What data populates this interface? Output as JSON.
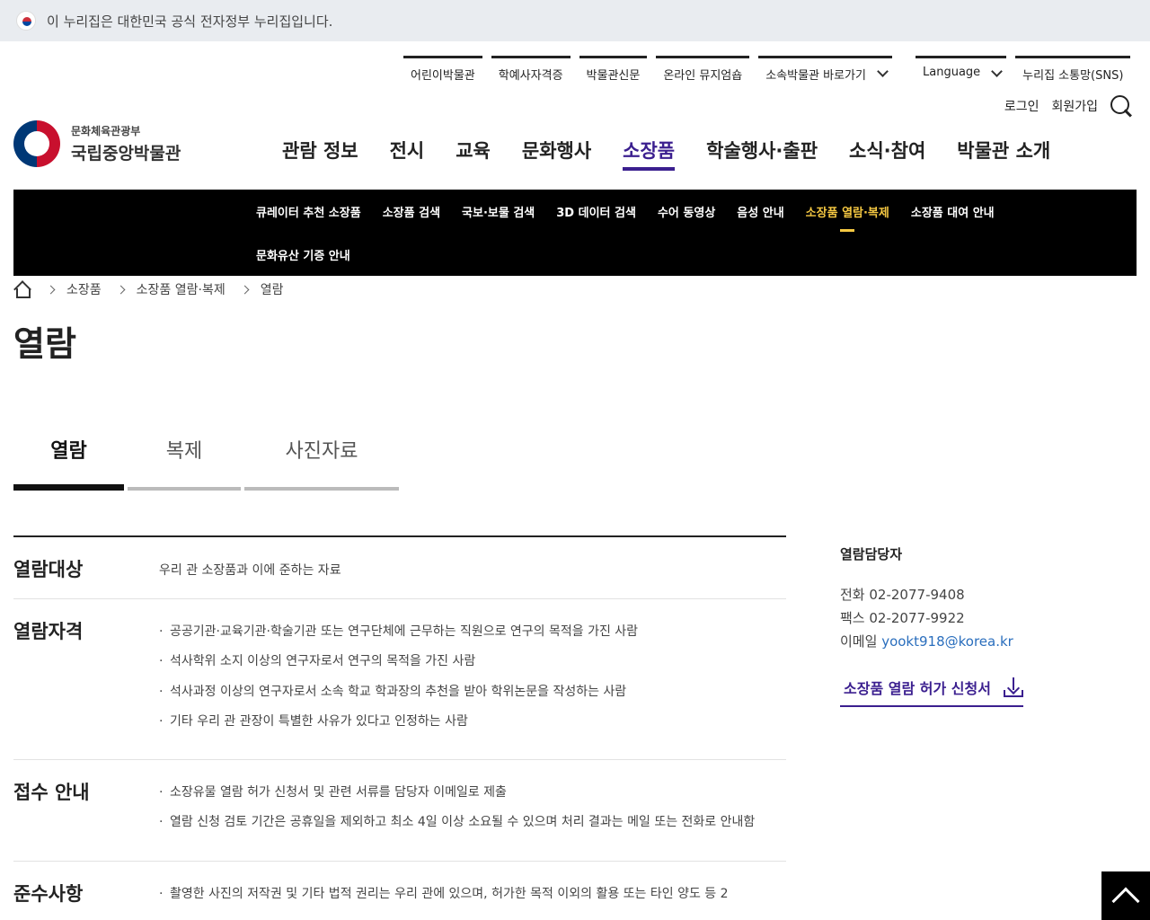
{
  "gov_banner": {
    "text": "이 누리집은 대한민국 공식 전자정부 누리집입니다."
  },
  "util_nav": {
    "items": [
      "어린이박물관",
      "학예사자격증",
      "박물관신문",
      "온라인 뮤지엄숍",
      "소속박물관 바로가기"
    ],
    "language": "Language",
    "sns": "누리집 소통망(SNS)"
  },
  "auth": {
    "login": "로그인",
    "signup": "회원가입"
  },
  "logo": {
    "sub": "문화체육관광부",
    "main": "국립중앙박물관"
  },
  "gnb": {
    "items": [
      "관람 정보",
      "전시",
      "교육",
      "문화행사",
      "소장품",
      "학술행사·출판",
      "소식·참여",
      "박물관 소개"
    ],
    "active_index": 4
  },
  "subnav": {
    "items": [
      "큐레이터 추천 소장품",
      "소장품 검색",
      "국보·보물 검색",
      "3D 데이터 검색",
      "수어 동영상",
      "음성 안내",
      "소장품 열람·복제",
      "소장품 대여 안내",
      "문화유산 기증 안내"
    ],
    "active_index": 6
  },
  "breadcrumb": [
    "소장품",
    "소장품 열람·복제",
    "열람"
  ],
  "page_title": "열람",
  "tabs": [
    "열람",
    "복제",
    "사진자료"
  ],
  "info": {
    "rows": [
      {
        "label": "열람대상",
        "text": "우리 관 소장품과 이에 준하는 자료"
      },
      {
        "label": "열람자격",
        "items": [
          "공공기관·교육기관·학술기관 또는 연구단체에 근무하는 직원으로 연구의 목적을 가진 사람",
          "석사학위 소지 이상의 연구자로서 연구의 목적을 가진 사람",
          "석사과정 이상의 연구자로서 소속 학교 학과장의 추천을 받아 학위논문을 작성하는 사람",
          "기타 우리 관 관장이 특별한 사유가 있다고 인정하는 사람"
        ]
      },
      {
        "label": "접수 안내",
        "items": [
          "소장유물 열람 허가 신청서 및 관련 서류를 담당자 이메일로 제출",
          "열람 신청 검토 기간은 공휴일을 제외하고 최소 4일 이상 소요될 수 있으며 처리 결과는 메일 또는 전화로 안내함"
        ]
      },
      {
        "label": "준수사항",
        "items": [
          "촬영한 사진의 저작권 및 기타 법적 권리는 우리 관에 있으며, 허가한 목적 이외의 활용 또는 타인 양도 등 2"
        ]
      }
    ]
  },
  "contact": {
    "title": "열람담당자",
    "phone_label": "전화",
    "phone": "02-2077-9408",
    "fax_label": "팩스",
    "fax": "02-2077-9922",
    "email_label": "이메일",
    "email": "yookt918@korea.kr",
    "download_label": "소장품 열람 허가 신청서"
  },
  "colors": {
    "accent": "#3b1f8f",
    "subnav_active": "#f5c842",
    "email": "#2a6ebd"
  }
}
